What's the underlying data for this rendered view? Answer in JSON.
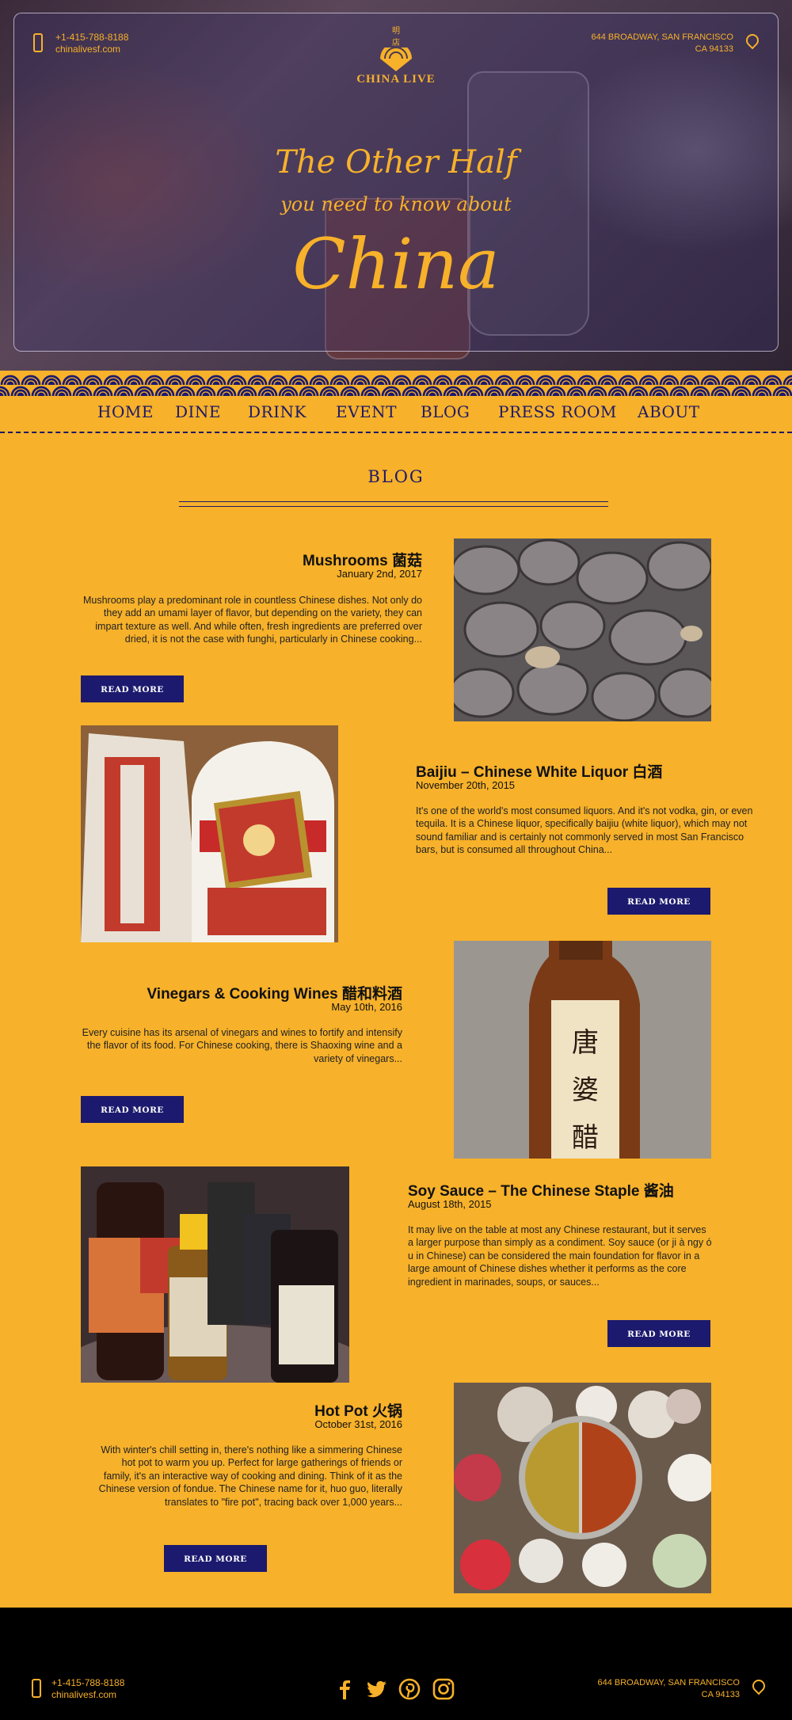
{
  "header": {
    "phone": "+1-415-788-8188",
    "website": "chinalivesf.com",
    "address_line1": "644 BROADWAY, SAN FRANCISCO",
    "address_line2": "CA 94133",
    "logo_chars": "明 店",
    "logo_name": "CHINA LIVE",
    "tagline1": "The Other Half",
    "tagline2": "you need to know about",
    "tagline3": "China"
  },
  "nav": [
    "HOME",
    "DINE",
    "DRINK",
    "EVENT",
    "BLOG",
    "PRESS ROOM",
    "ABOUT"
  ],
  "page_title": "BLOG",
  "posts": [
    {
      "title": "Mushrooms 菌菇",
      "date": "January 2nd, 2017",
      "excerpt": "Mushrooms play a predominant role in countless Chinese dishes. Not only do they add an umami layer of flavor, but depending on the variety, they can impart texture as well. And while often, fresh ingredients are preferred over dried, it is not the case with funghi, particularly in Chinese cooking...",
      "button": "READ MORE"
    },
    {
      "title": "Baijiu – Chinese White Liquor 白酒",
      "date": "November 20th, 2015",
      "excerpt": "It's one of the world's most consumed liquors. And it's not vodka, gin, or even tequila. It is a Chinese liquor, specifically baijiu (white liquor), which may not sound familiar and is certainly not commonly served in most San Francisco bars, but is consumed all throughout China...",
      "button": "READ MORE"
    },
    {
      "title": "Vinegars & Cooking Wines 醋和料酒",
      "date": "May 10th, 2016",
      "excerpt": "Every cuisine has its arsenal of vinegars and wines to fortify and intensify the flavor of its food. For Chinese cooking, there is Shaoxing wine and a variety of vinegars...",
      "button": "READ MORE"
    },
    {
      "title": "Soy Sauce – The Chinese Staple 酱油",
      "date": "August 18th, 2015",
      "excerpt": "It may live on the table at most any Chinese restaurant, but it serves a larger purpose than simply as a condiment. Soy sauce (or ji à ngy ó u in Chinese) can be considered the main foundation for flavor in a large amount of Chinese dishes whether it performs as the core ingredient in marinades, soups, or sauces...",
      "button": "READ MORE"
    },
    {
      "title": "Hot Pot 火锅",
      "date": "October 31st, 2016",
      "excerpt": "With winter's chill setting in, there's nothing like a simmering Chinese hot pot to warm you up. Perfect for large gatherings of friends or family, it's an interactive way of cooking and dining. Think of it as the Chinese version of fondue. The Chinese name for it, huo guo, literally translates to \"fire pot\", tracing back over 1,000 years...",
      "button": "READ MORE"
    }
  ],
  "bottle_label": "唐婆醋",
  "footer": {
    "phone": "+1-415-788-8188",
    "website": "chinalivesf.com",
    "address_line1": "644 BROADWAY, SAN FRANCISCO",
    "address_line2": "CA 94133",
    "social": [
      "facebook-icon",
      "twitter-icon",
      "pinterest-icon",
      "instagram-icon"
    ]
  },
  "colors": {
    "accent": "#f7b12a",
    "navy": "#1c1a6e",
    "footer": "#000000"
  }
}
